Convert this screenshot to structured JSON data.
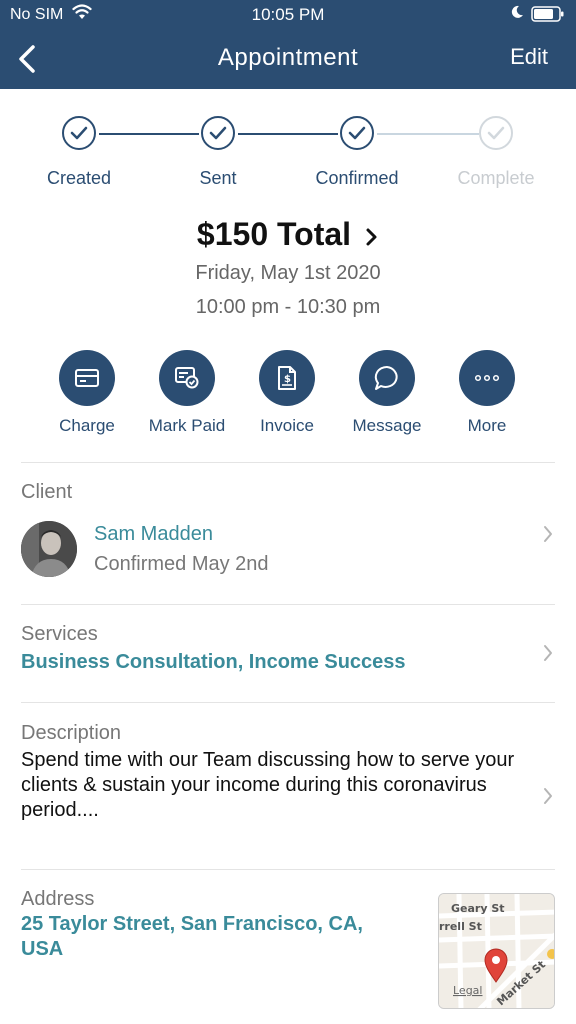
{
  "status_bar": {
    "carrier": "No SIM",
    "time": "10:05 PM"
  },
  "nav": {
    "title": "Appointment",
    "edit_label": "Edit"
  },
  "stepper": {
    "steps": [
      {
        "label": "Created",
        "done": true
      },
      {
        "label": "Sent",
        "done": true
      },
      {
        "label": "Confirmed",
        "done": true
      },
      {
        "label": "Complete",
        "done": false
      }
    ]
  },
  "summary": {
    "total": "$150 Total",
    "date": "Friday, May 1st 2020",
    "time": "10:00 pm - 10:30 pm"
  },
  "actions": [
    {
      "label": "Charge",
      "icon": "card-icon"
    },
    {
      "label": "Mark Paid",
      "icon": "receipt-check-icon"
    },
    {
      "label": "Invoice",
      "icon": "invoice-icon"
    },
    {
      "label": "Message",
      "icon": "chat-bubble-icon"
    },
    {
      "label": "More",
      "icon": "more-dots-icon"
    }
  ],
  "client": {
    "section_label": "Client",
    "name": "Sam Madden",
    "status": "Confirmed May 2nd"
  },
  "services": {
    "section_label": "Services",
    "value": "Business Consultation, Income Success"
  },
  "description": {
    "section_label": "Description",
    "text": "Spend time with our Team discussing how to serve your clients & sustain your income during this coronavirus period...."
  },
  "address": {
    "section_label": "Address",
    "line1": "25 Taylor Street, San Francisco, CA,",
    "line2": "USA",
    "map_labels": {
      "street1": "Geary St",
      "street2": "rrell St",
      "street3": "Market St",
      "legal": "Legal"
    }
  },
  "colors": {
    "brand": "#2b4d72",
    "link": "#3a8b9a",
    "pin": "#e0443a"
  }
}
